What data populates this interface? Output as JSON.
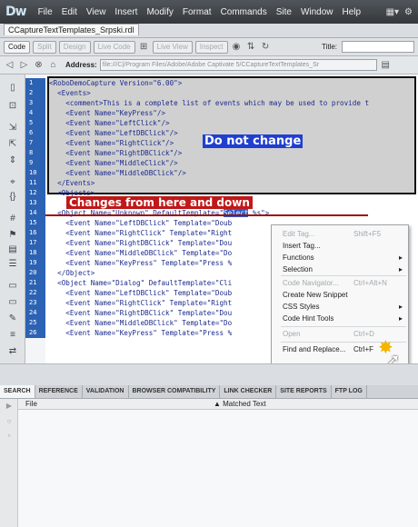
{
  "app": {
    "logo": "Dw"
  },
  "menubar": {
    "items": [
      "File",
      "Edit",
      "View",
      "Insert",
      "Modify",
      "Format",
      "Commands",
      "Site",
      "Window",
      "Help"
    ],
    "right_icons": [
      "layout-icon",
      "gear-icon"
    ]
  },
  "document": {
    "tab_label": "CCaptureTextTemplates_Srpski.rdl"
  },
  "toolbar": {
    "code": "Code",
    "split": "Split",
    "design": "Design",
    "live_code": "Live Code",
    "live_view": "Live View",
    "inspect": "Inspect",
    "title_label": "Title:"
  },
  "address": {
    "label": "Address:",
    "value": "file:///C|/Program Files/Adobe/Adobe Captivate 5/CCaptureTextTemplates_Sr"
  },
  "code": {
    "line_numbers": [
      "1",
      "2",
      "3",
      "4",
      "5",
      "6",
      "7",
      "8",
      "9",
      "10",
      "11",
      "12",
      "13",
      "14",
      "15",
      "16",
      "17",
      "18",
      "19",
      "20",
      "21",
      "22",
      "23",
      "24",
      "25",
      "26"
    ],
    "lines": [
      "<RoboDemoCapture Version=\"6.00\">",
      "  <Events>",
      "    <comment>This is a complete list of events which may be used to provide t",
      "    <Event Name=\"KeyPress\"/>",
      "    <Event Name=\"LeftClick\"/>",
      "    <Event Name=\"LeftDBClick\"/>",
      "    <Event Name=\"RightClick\"/>",
      "    <Event Name=\"RightDBClick\"/>",
      "    <Event Name=\"MiddleClick\"/>",
      "    <Event Name=\"MiddleDBClick\"/>",
      "  </Events>",
      "  <Objects>",
      "",
      "  <Object Name=\"Unknown\" DefaultTemplate=\"Select %s\">",
      "    <Event Name=\"LeftDBClick\" Template=\"Doub",
      "    <Event Name=\"RightClick\" Template=\"Right",
      "    <Event Name=\"RightDBClick\" Template=\"Dou",
      "    <Event Name=\"MiddleDBClick\" Template=\"Do",
      "    <Event Name=\"KeyPress\" Template=\"Press %",
      "  </Object>",
      "  <Object Name=\"Dialog\" DefaultTemplate=\"Cli",
      "    <Event Name=\"LeftDBClick\" Template=\"Doub",
      "    <Event Name=\"RightClick\" Template=\"Right",
      "    <Event Name=\"RightDBClick\" Template=\"Dou",
      "    <Event Name=\"MiddleDBClick\" Template=\"Do",
      "    <Event Name=\"KeyPress\" Template=\"Press %"
    ]
  },
  "annotations": {
    "do_not_change": "Do not change",
    "changes_from_here": "Changes from here and down"
  },
  "context_menu": {
    "items": [
      {
        "label": "Edit Tag...",
        "shortcut": "Shift+F5",
        "disabled": true
      },
      {
        "label": "Insert Tag...",
        "shortcut": "",
        "disabled": false
      },
      {
        "label": "Functions",
        "shortcut": "",
        "disabled": false,
        "submenu": true
      },
      {
        "label": "Selection",
        "shortcut": "",
        "disabled": false,
        "submenu": true
      },
      {
        "label": "Code Navigator...",
        "shortcut": "Ctrl+Alt+N",
        "disabled": true
      },
      {
        "label": "Create New Snippet",
        "shortcut": "",
        "disabled": false
      },
      {
        "label": "CSS Styles",
        "shortcut": "",
        "disabled": false,
        "submenu": true
      },
      {
        "label": "Code Hint Tools",
        "shortcut": "",
        "disabled": false,
        "submenu": true
      },
      {
        "label": "Open",
        "shortcut": "Ctrl+D",
        "disabled": true
      },
      {
        "label": "Find and Replace...",
        "shortcut": "Ctrl+F",
        "disabled": false
      }
    ]
  },
  "panel": {
    "tabs": [
      "SEARCH",
      "REFERENCE",
      "VALIDATION",
      "BROWSER COMPATIBILITY",
      "LINK CHECKER",
      "SITE REPORTS",
      "FTP LOG"
    ],
    "columns": {
      "file": "File",
      "matched": "Matched Text"
    }
  }
}
